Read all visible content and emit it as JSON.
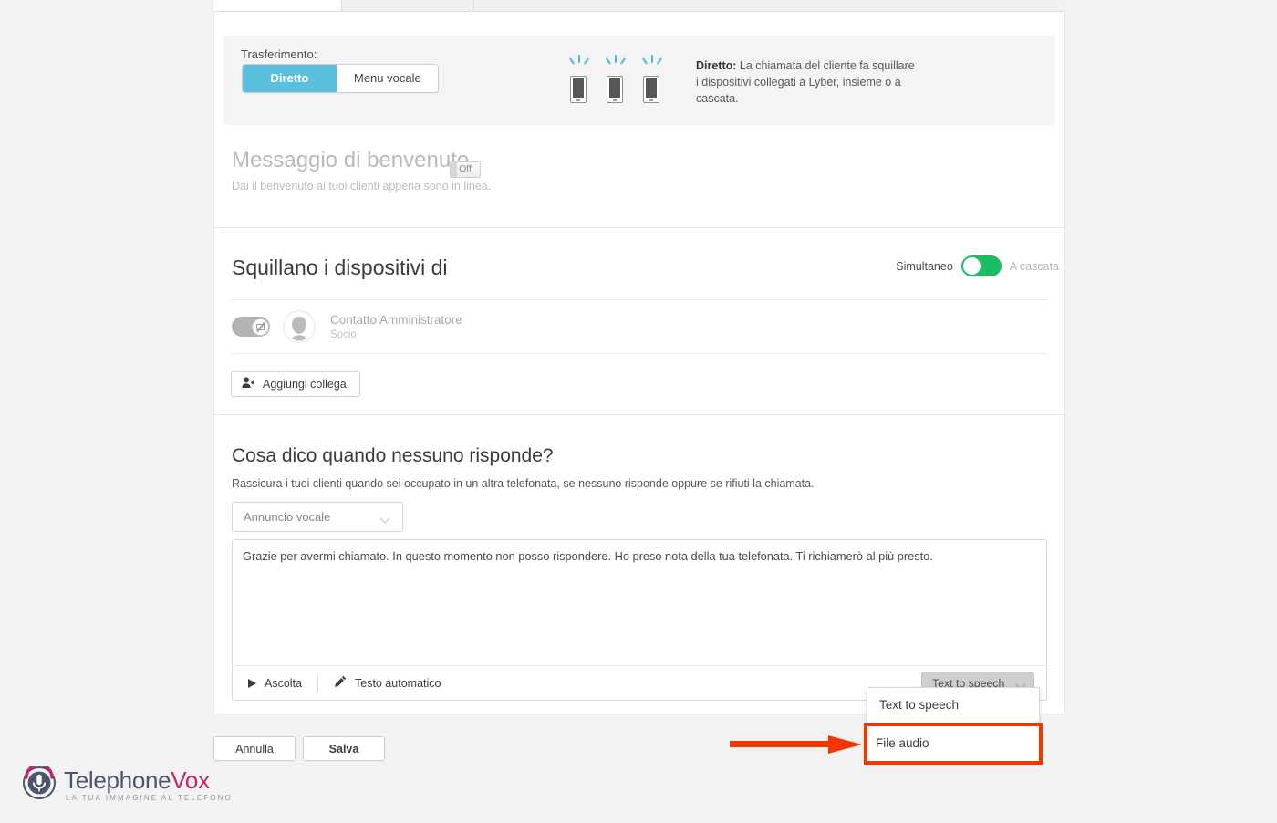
{
  "transfer": {
    "label": "Trasferimento:",
    "options": [
      "Diretto",
      "Menu vocale"
    ],
    "selected": "Diretto",
    "desc_strong": "Diretto:",
    "desc_text": " La chiamata del cliente fa squillare i dispositivi collegati a Lyber, insieme o a cascata.",
    "accent_color": "#5bc0de"
  },
  "welcome": {
    "title": "Messaggio di benvenuto",
    "state_badge": "Off",
    "subtitle": "Dai il benvenuto ai tuoi clienti appena sono in linea."
  },
  "ring_devices": {
    "title": "Squillano i dispositivi di",
    "mode_left": "Simultaneo",
    "mode_right": "A cascata",
    "toggle_color": "#1cbc62",
    "contact": {
      "name": "Contatto Amministratore",
      "role": "Socio"
    },
    "add_colleague_label": "Aggiungi collega"
  },
  "no_answer": {
    "title": "Cosa dico quando nessuno risponde?",
    "subtitle": "Rassicura i tuoi clienti quando sei occupato in un altra telefonata, se nessuno risponde oppure se rifiuti la chiamata.",
    "announcement_select": "Annuncio vocale",
    "message_text": "Grazie per avermi chiamato. In questo momento non posso rispondere. Ho preso nota della tua telefonata. Ti richiamerò al più presto.",
    "listen_label": "Ascolta",
    "auto_text_label": "Testo automatico",
    "source_select_value": "Text to speech",
    "source_options": [
      "Text to speech",
      "File audio"
    ],
    "highlighted_option": "File audio",
    "highlight_color": "#f43600"
  },
  "footer": {
    "cancel_label": "Annulla",
    "save_label": "Salva"
  },
  "brand": {
    "name_first": "Telephone",
    "name_second": "Vox",
    "tagline": "LA TUA IMMAGINE AL TELEFONO",
    "color_primary": "#4a5570",
    "color_accent": "#c2256c"
  }
}
